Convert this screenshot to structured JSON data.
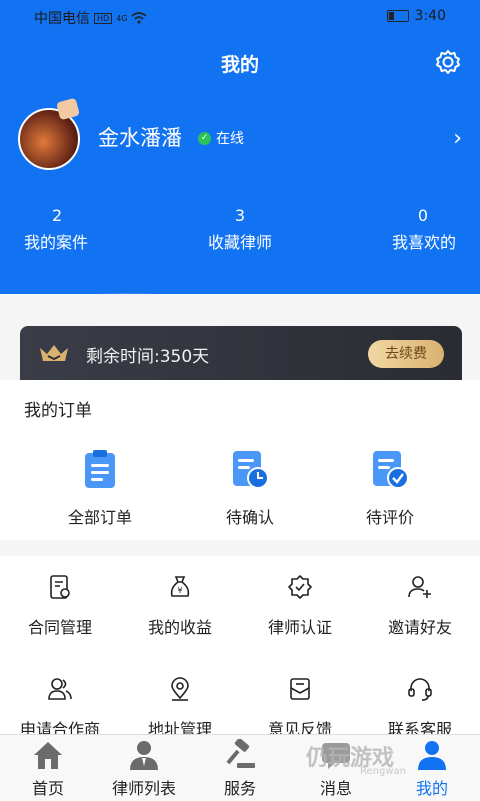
{
  "status_bar": {
    "carrier": "中国电信",
    "hd": "HD",
    "network": "4G",
    "time": "3:40"
  },
  "header": {
    "title": "我的"
  },
  "user": {
    "name": "金水潘潘",
    "status": "在线"
  },
  "stats": [
    {
      "count": "2",
      "label": "我的案件"
    },
    {
      "count": "3",
      "label": "收藏律师"
    },
    {
      "count": "0",
      "label": "我喜欢的"
    }
  ],
  "membership": {
    "remaining": "剩余时间:350天",
    "renew_label": "去续费"
  },
  "orders": {
    "heading": "我的订单",
    "items": [
      {
        "label": "全部订单",
        "icon": "clipboard-icon"
      },
      {
        "label": "待确认",
        "icon": "pending-confirm-icon"
      },
      {
        "label": "待评价",
        "icon": "pending-review-icon"
      }
    ]
  },
  "services": [
    {
      "label": "合同管理",
      "icon": "contract-icon"
    },
    {
      "label": "我的收益",
      "icon": "money-bag-icon"
    },
    {
      "label": "律师认证",
      "icon": "certified-badge-icon"
    },
    {
      "label": "邀请好友",
      "icon": "add-user-icon"
    },
    {
      "label": "申请合作商",
      "icon": "partner-icon"
    },
    {
      "label": "地址管理",
      "icon": "location-icon"
    },
    {
      "label": "意见反馈",
      "icon": "feedback-icon"
    },
    {
      "label": "联系客服",
      "icon": "headset-icon"
    }
  ],
  "tabs": [
    {
      "label": "首页",
      "icon": "home-icon"
    },
    {
      "label": "律师列表",
      "icon": "lawyer-icon"
    },
    {
      "label": "服务",
      "icon": "gavel-icon"
    },
    {
      "label": "消息",
      "icon": "message-icon"
    },
    {
      "label": "我的",
      "icon": "profile-icon"
    }
  ],
  "watermark": {
    "text": "仍玩游戏",
    "sub": "Rengwan"
  },
  "colors": {
    "primary": "#1273f2",
    "gold": "#d9b270",
    "member_bg": "#2f3138"
  }
}
